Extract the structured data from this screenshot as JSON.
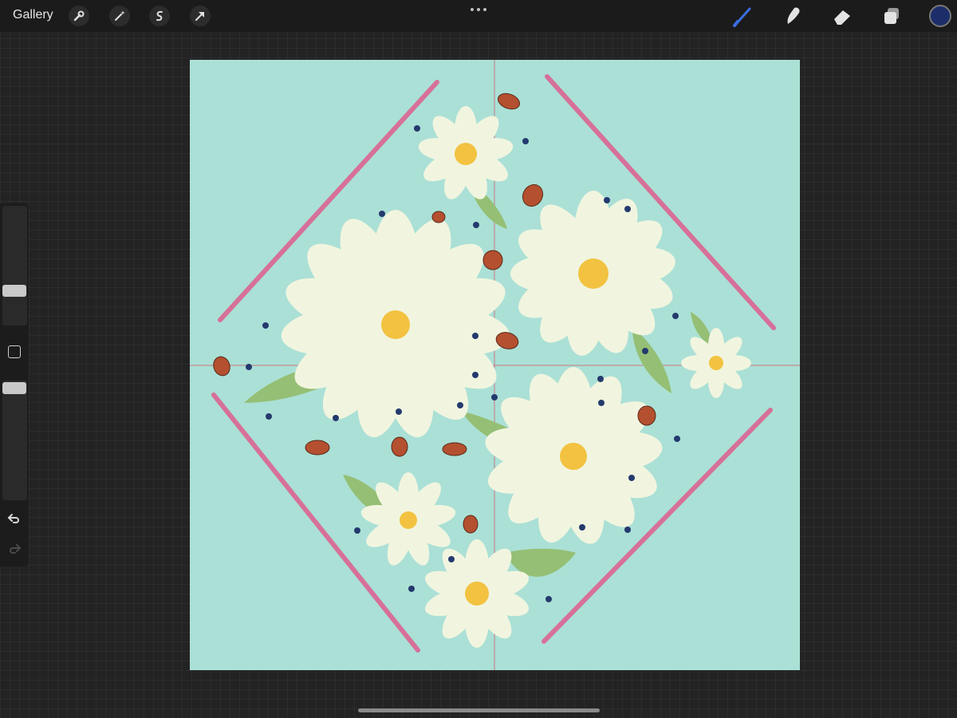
{
  "topbar": {
    "gallery_label": "Gallery",
    "left_tools": [
      "wrench-icon",
      "magic-wand-icon",
      "selection-s-icon",
      "transform-arrow-icon"
    ],
    "right_tools": [
      "brush-icon",
      "smudge-icon",
      "eraser-icon",
      "layers-icon"
    ],
    "active_tool": "brush-icon",
    "active_tool_color": "#3a6fe0",
    "current_color": "#1c2e6a"
  },
  "sidebar": {
    "controls": [
      "brush-size-slider",
      "modify-button",
      "opacity-slider",
      "undo-icon",
      "redo-icon"
    ]
  },
  "canvas": {
    "background_color": "#abe0d6",
    "guide_color": "#c57a83",
    "line_color": "#d6709a",
    "petal_color": "#f1f5df",
    "center_color": "#f2c240",
    "leaf_color": "#95bf74",
    "ladybug_color": "#b4502f",
    "dot_color": "#243a6e"
  }
}
